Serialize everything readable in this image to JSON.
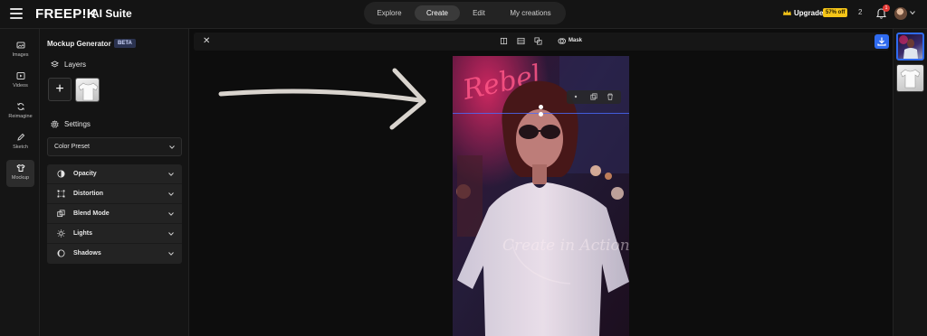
{
  "topbar": {
    "logo": "FREEP!K",
    "logo_sub": "AI Suite",
    "nav": [
      {
        "label": "Explore"
      },
      {
        "label": "Create"
      },
      {
        "label": "Edit"
      },
      {
        "label": "My creations"
      }
    ],
    "active_nav": "Create",
    "upgrade_label": "Upgrade",
    "discount_badge": "57% off",
    "small_counter": "2",
    "notification_count": "1"
  },
  "rail": {
    "items": [
      {
        "label": "Images",
        "icon": "images-icon"
      },
      {
        "label": "Videos",
        "icon": "videos-icon"
      },
      {
        "label": "Reimagine",
        "icon": "reimagine-icon"
      },
      {
        "label": "Sketch",
        "icon": "sketch-icon"
      },
      {
        "label": "Mockup",
        "icon": "mockup-icon"
      }
    ],
    "active_item": "Mockup"
  },
  "panel": {
    "title": "Mockup Generator",
    "badge": "BETA",
    "layers_heading": "Layers",
    "add_layer_symbol": "+",
    "settings_heading": "Settings",
    "preset_select_value": "Color Preset",
    "accordions": [
      {
        "label": "Opacity",
        "icon": "opacity-icon"
      },
      {
        "label": "Distortion",
        "icon": "distortion-icon"
      },
      {
        "label": "Blend Mode",
        "icon": "blend-mode-icon"
      },
      {
        "label": "Lights",
        "icon": "lights-icon"
      },
      {
        "label": "Shadows",
        "icon": "shadows-icon"
      }
    ]
  },
  "canvas": {
    "close_symbol": "✕",
    "mask_label": "Mask",
    "shirt_print_text": "Create in Action",
    "neon_sign_text": "Rebel"
  },
  "colors": {
    "accent_blue": "#2f6bf0",
    "badge_yellow": "#f5c518",
    "notification_red": "#e53935"
  }
}
